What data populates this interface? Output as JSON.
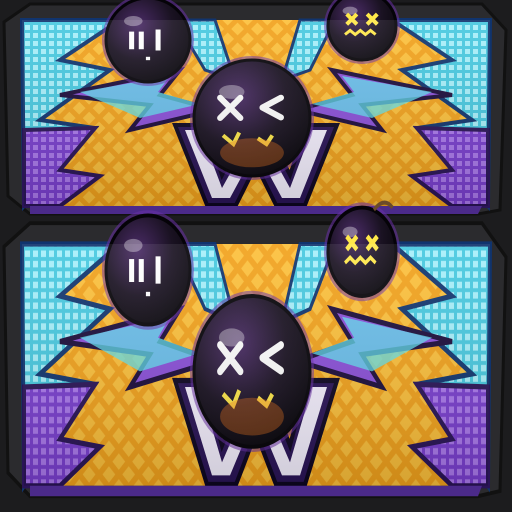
{
  "texture": {
    "panel_count": 2,
    "bombs_per_panel": 3,
    "faces": [
      "sleepy-face",
      "dizzy-face",
      "grimace-face"
    ]
  },
  "colors": {
    "background": "#1c1c1e",
    "border": "#2b2b2e",
    "gold": "#f2a21c",
    "gold_light": "#ffd15a",
    "cyan": "#5fe3f0",
    "cyan_dark": "#1f8fb0",
    "purple": "#8a4fd8",
    "purple_dark": "#4b2a8a",
    "bomb": "#141018",
    "bomb_glow": "#6a2fa8",
    "face_white": "#ffffff",
    "face_yellow": "#ffe84a",
    "ember": "#ff7a1a"
  }
}
